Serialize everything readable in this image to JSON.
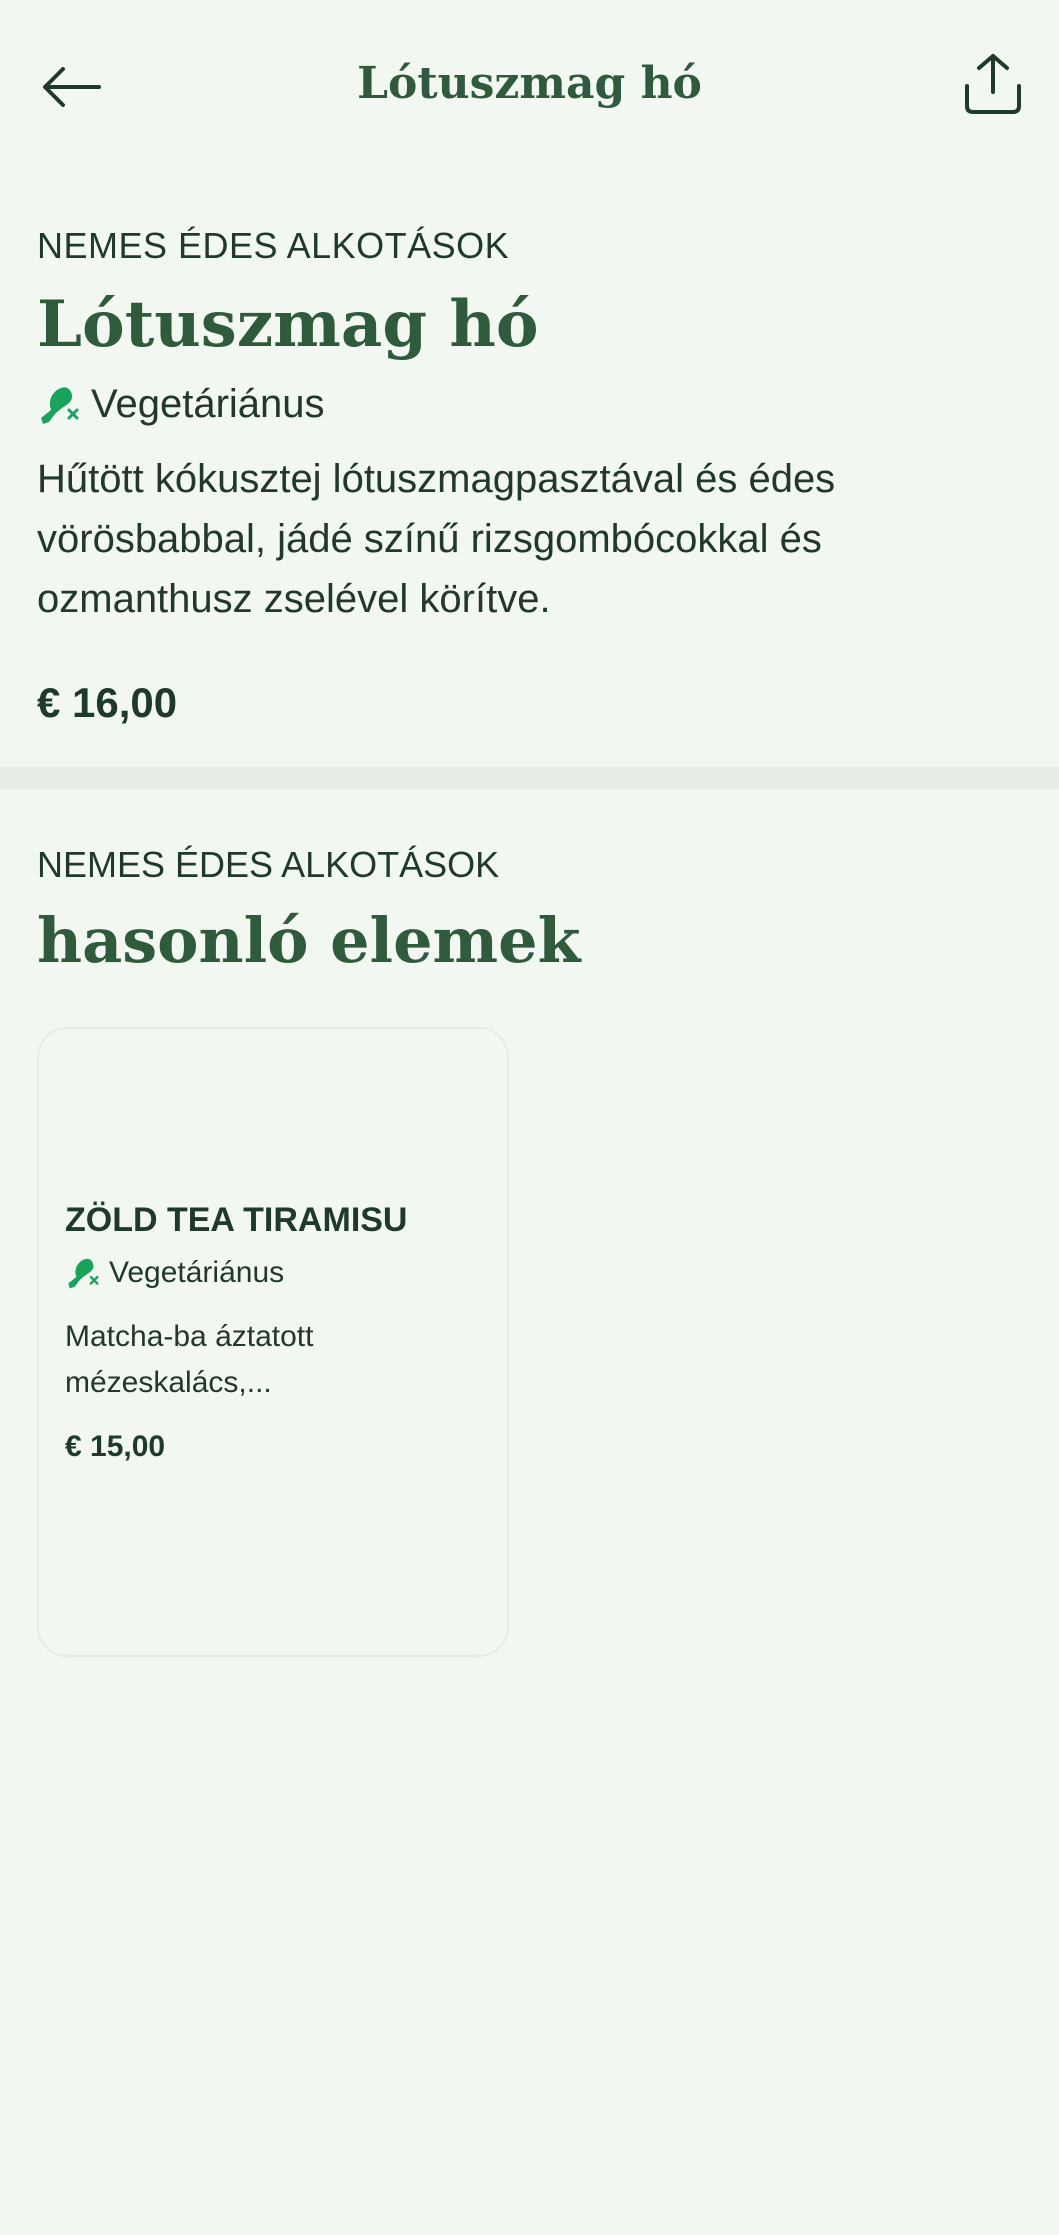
{
  "header": {
    "title": "Lótuszmag hó"
  },
  "icons": {
    "back": "arrow-left-icon",
    "share": "share-icon",
    "diet": "vegetarian-leg-icon"
  },
  "colors": {
    "accent_green": "#2f5a3c",
    "badge_green": "#1aa35c",
    "background": "#f3f7f2"
  },
  "product": {
    "category": "NEMES ÉDES ALKOTÁSOK",
    "title": "Lótuszmag hó",
    "diet": "Vegetáriánus",
    "description": "Hűtött kókusztej lótuszmagpasztával és édes vörösbabbal, jádé színű rizsgombócokkal és ozmanthusz zselével körítve.",
    "price": "€ 16,00"
  },
  "related": {
    "category": "NEMES ÉDES ALKOTÁSOK",
    "title": "hasonló elemek",
    "items": [
      {
        "title": "ZÖLD TEA TIRAMISU",
        "diet": "Vegetáriánus",
        "description": "Matcha-ba áztatott mézeskalács,...",
        "price": "€ 15,00"
      }
    ]
  }
}
